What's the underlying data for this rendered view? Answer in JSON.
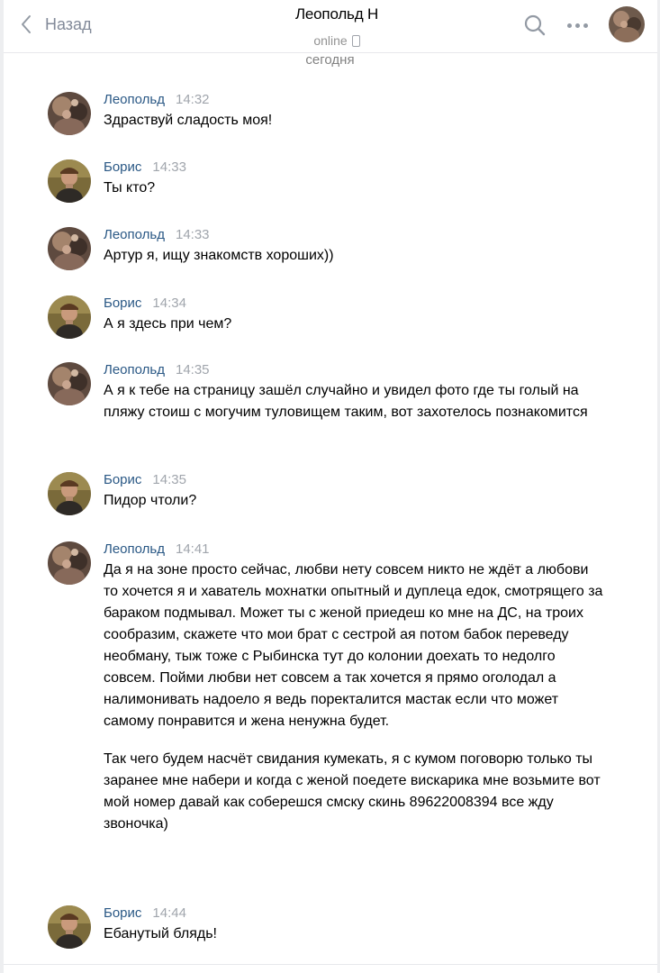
{
  "header": {
    "back_label": "Назад",
    "title": "Леопольд Н",
    "status": "online"
  },
  "day_separator": "сегодня",
  "messages": [
    {
      "author": "Леопольд",
      "time": "14:32",
      "avatar": "leopold",
      "paragraphs": [
        "Здраствуй сладость моя!"
      ]
    },
    {
      "author": "Борис",
      "time": "14:33",
      "avatar": "boris",
      "paragraphs": [
        "Ты кто?"
      ]
    },
    {
      "author": "Леопольд",
      "time": "14:33",
      "avatar": "leopold",
      "paragraphs": [
        "Артур я, ищу знакомств хороших))"
      ]
    },
    {
      "author": "Борис",
      "time": "14:34",
      "avatar": "boris",
      "paragraphs": [
        "А я здесь при чем?"
      ]
    },
    {
      "author": "Леопольд",
      "time": "14:35",
      "avatar": "leopold",
      "paragraphs": [
        "А я к тебе на страницу зашёл случайно и увидел фото где ты голый на пляжу стоиш с могучим туловищем таким, вот захотелось познакомится"
      ]
    },
    {
      "author": "Борис",
      "time": "14:35",
      "avatar": "boris",
      "paragraphs": [
        "Пидор чтоли?"
      ]
    },
    {
      "author": "Леопольд",
      "time": "14:41",
      "avatar": "leopold",
      "paragraphs": [
        "Да я на зоне просто сейчас, любви нету совсем никто не ждёт а любови то хочется я и хаватель мохнатки опытный и дуплеца едок, смотрящего за бараком подмывал. Может ты с женой приедеш ко мне на ДС, на троих сообразим, скажете что мои брат с сестрой ая потом бабок переведу необману, тыж тоже с Рыбинска тут до колонии доехать то недолго совсем. Пойми любви нет совсем а так хочется я прямо оголодал а налимонивать надоело я ведь поректалится мастак если что может самому понравится и жена ненужна будет.",
        "Так чего будем насчёт свидания кумекать, я с кумом поговорю только ты заранее мне набери и когда с женой поедете вискарика мне возьмите вот мой номер давай как соберешся смску скинь 89622008394 все жду звоночка)"
      ]
    },
    {
      "author": "Борис",
      "time": "14:44",
      "avatar": "boris",
      "paragraphs": [
        "Ебанутый блядь!"
      ]
    }
  ]
}
